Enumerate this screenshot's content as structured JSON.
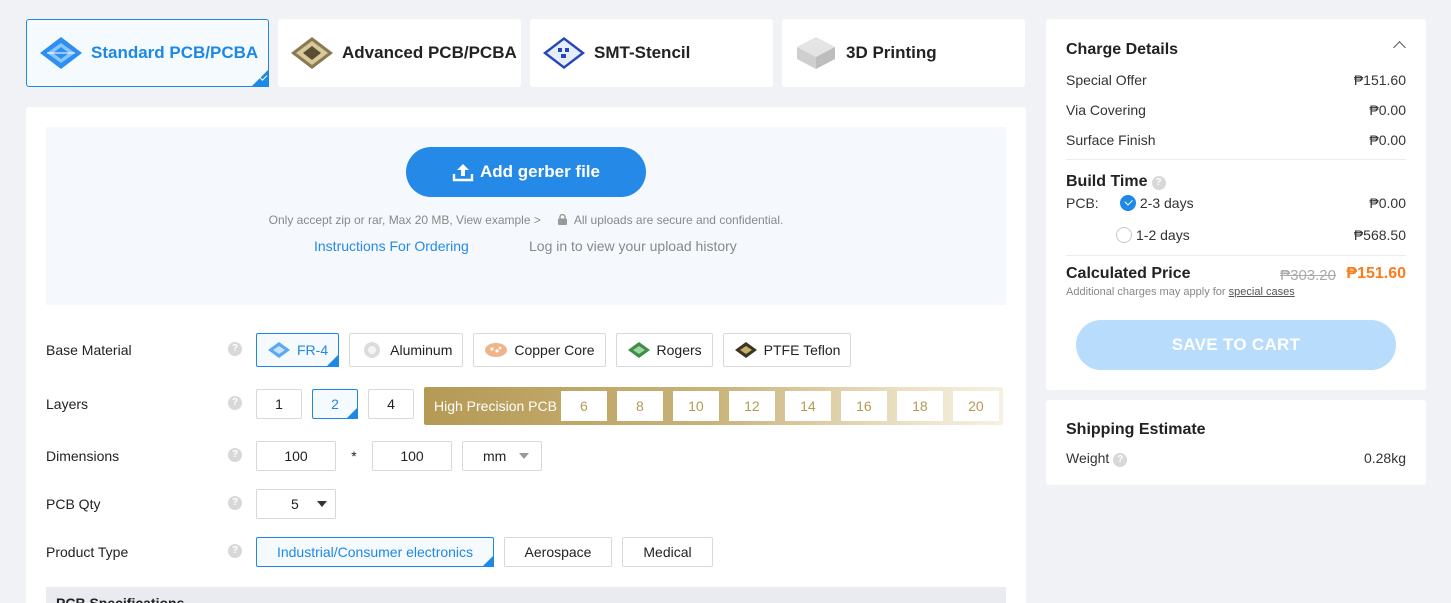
{
  "tabs": [
    {
      "label": "Standard PCB/PCBA",
      "icon": "standard-pcb-icon",
      "active": true
    },
    {
      "label": "Advanced PCB/PCBA",
      "icon": "advanced-pcb-icon"
    },
    {
      "label": "SMT-Stencil",
      "icon": "smt-stencil-icon"
    },
    {
      "label": "3D Printing",
      "icon": "3d-printing-icon"
    }
  ],
  "upload": {
    "button_label": "Add gerber file",
    "note": "Only accept zip or rar, Max 20 MB, View example >",
    "secure_note": "All uploads are secure and confidential.",
    "instructions_link": "Instructions For Ordering",
    "history_link": "Log in to view your upload history"
  },
  "form": {
    "base_material": {
      "label": "Base Material",
      "options": [
        "FR-4",
        "Aluminum",
        "Copper Core",
        "Rogers",
        "PTFE Teflon"
      ],
      "selected": "FR-4"
    },
    "layers": {
      "label": "Layers",
      "options": [
        "1",
        "2",
        "4"
      ],
      "selected": "2",
      "high_precision_label": "High Precision PCB",
      "high_precision_options": [
        "6",
        "8",
        "10",
        "12",
        "14",
        "16",
        "18",
        "20"
      ]
    },
    "dimensions": {
      "label": "Dimensions",
      "width": "100",
      "separator": "*",
      "height": "100",
      "unit": "mm"
    },
    "qty": {
      "label": "PCB Qty",
      "value": "5"
    },
    "product_type": {
      "label": "Product Type",
      "options": [
        "Industrial/Consumer electronics",
        "Aerospace",
        "Medical"
      ],
      "selected": "Industrial/Consumer electronics"
    },
    "spec_section": "PCB Specifications",
    "help_glyph": "?"
  },
  "charge": {
    "title": "Charge Details",
    "lines": [
      {
        "label": "Special Offer",
        "value": "₱151.60"
      },
      {
        "label": "Via Covering",
        "value": "₱0.00"
      },
      {
        "label": "Surface Finish",
        "value": "₱0.00"
      }
    ],
    "build_time": {
      "title": "Build Time",
      "pcb_label": "PCB:",
      "options": [
        {
          "label": "2-3 days",
          "value": "₱0.00",
          "selected": true
        },
        {
          "label": "1-2 days",
          "value": "₱568.50",
          "selected": false
        }
      ]
    },
    "calculated": {
      "title": "Calculated Price",
      "old_price": "₱303.20",
      "price": "₱151.60",
      "note": "Additional charges may apply for",
      "note_link": "special cases"
    },
    "save_label": "SAVE TO CART"
  },
  "shipping": {
    "title": "Shipping Estimate",
    "weight_label": "Weight",
    "weight_value": "0.28kg"
  },
  "colors": {
    "accent": "#1e88e5",
    "price": "#ff7a1a",
    "gold": "#b59a55"
  }
}
